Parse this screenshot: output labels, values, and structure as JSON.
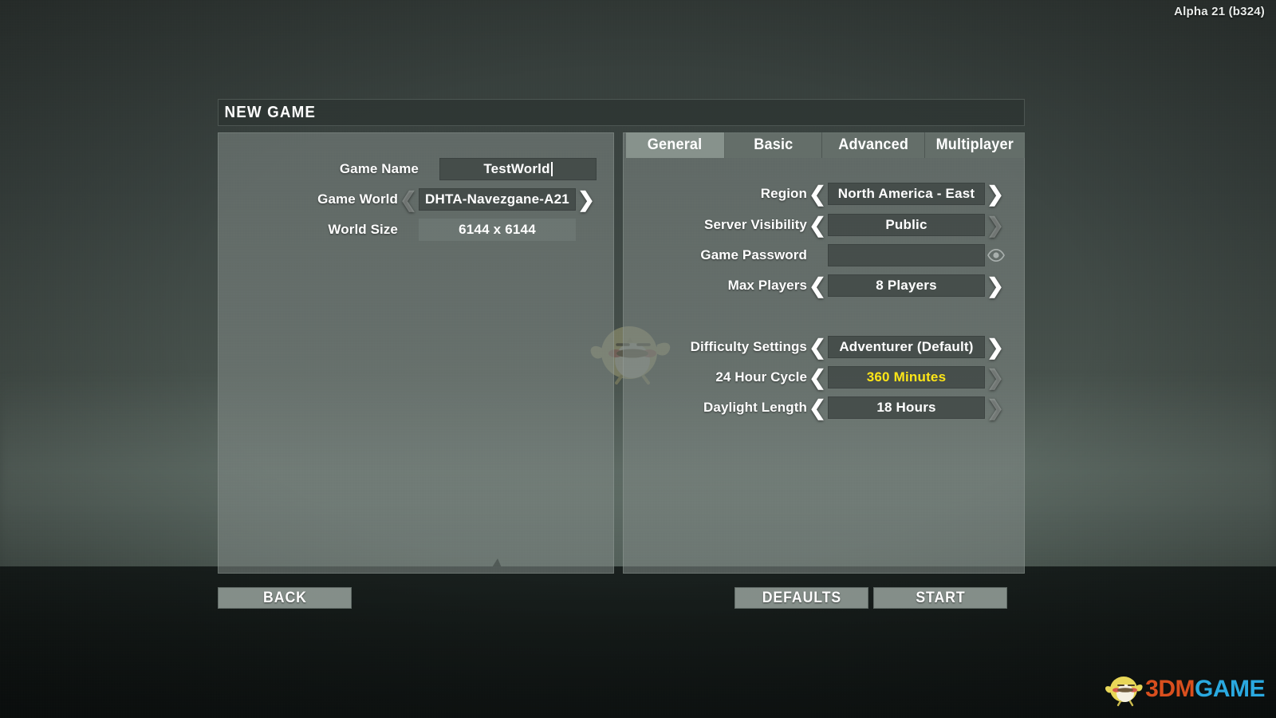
{
  "version_text": "Alpha 21 (b324)",
  "window": {
    "title": "NEW GAME"
  },
  "colors": {
    "accent_yellow": "#ffe617",
    "panel_gray": "#818b86",
    "field_dark": "#3e4643",
    "watermark_orange": "#d94f1e",
    "watermark_blue": "#2aa9e0"
  },
  "left_panel": {
    "rows": [
      {
        "label": "Game Name",
        "value": "TestWorld",
        "placeholder": "",
        "type": "text-input",
        "has_caret": true,
        "left_arrow": "none",
        "right_arrow": "none"
      },
      {
        "label": "Game World",
        "value": "DHTA-Navezgane-A21",
        "type": "stepper",
        "has_caret": false,
        "left_arrow": "dim",
        "right_arrow": "bright"
      },
      {
        "label": "World Size",
        "value": "6144 x 6144",
        "type": "readonly",
        "has_caret": false,
        "left_arrow": "none",
        "right_arrow": "none"
      }
    ]
  },
  "right_panel": {
    "tabs": [
      {
        "label": "General",
        "active": true
      },
      {
        "label": "Basic",
        "active": false
      },
      {
        "label": "Advanced",
        "active": false
      },
      {
        "label": "Multiplayer",
        "active": false
      }
    ],
    "group_one": [
      {
        "label": "Region",
        "value": "North America - East",
        "type": "stepper",
        "left_arrow": "bright",
        "right_arrow": "bright",
        "highlight": false
      },
      {
        "label": "Server Visibility",
        "value": "Public",
        "type": "stepper",
        "left_arrow": "bright",
        "right_arrow": "dim",
        "highlight": false
      },
      {
        "label": "Game Password",
        "value": "",
        "type": "password",
        "left_arrow": "none",
        "right_arrow": "none",
        "reveal_icon": "eye-icon",
        "highlight": false
      },
      {
        "label": "Max Players",
        "value": "8 Players",
        "type": "stepper",
        "left_arrow": "bright",
        "right_arrow": "bright",
        "highlight": false
      }
    ],
    "group_two": [
      {
        "label": "Difficulty Settings",
        "value": "Adventurer (Default)",
        "type": "stepper",
        "left_arrow": "bright",
        "right_arrow": "bright",
        "highlight": false
      },
      {
        "label": "24 Hour Cycle",
        "value": "360 Minutes",
        "type": "stepper",
        "left_arrow": "bright",
        "right_arrow": "dim",
        "highlight": true
      },
      {
        "label": "Daylight Length",
        "value": "18 Hours",
        "type": "stepper",
        "left_arrow": "bright",
        "right_arrow": "dim",
        "highlight": false
      }
    ]
  },
  "footer": {
    "back_label": "BACK",
    "defaults_label": "DEFAULTS",
    "start_label": "START"
  },
  "watermark": {
    "part_one": "3DM",
    "part_two": "GAME",
    "mascot": "bird-mascot-icon"
  },
  "icons": {
    "left_arrow": "chevron-left-icon",
    "right_arrow": "chevron-right-icon",
    "eye": "eye-icon"
  }
}
